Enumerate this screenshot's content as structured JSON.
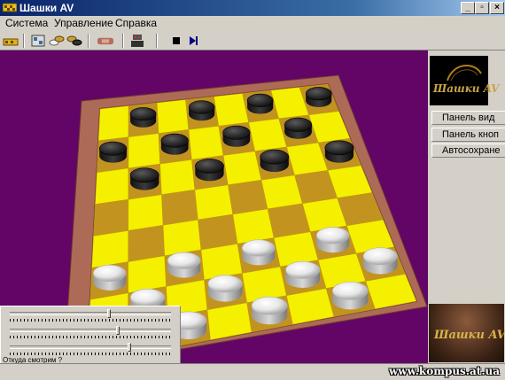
{
  "window": {
    "title": "Шашки AV",
    "icon": "checkers-app-icon",
    "controls": {
      "minimize": "_",
      "maximize": "▫",
      "close": "×"
    }
  },
  "menu": {
    "items": [
      "Система",
      "Управление",
      "Справка"
    ]
  },
  "toolbar": {
    "icons": [
      "new-game-icon",
      "board-view-icon",
      "white-pieces-icon",
      "handshake-icon",
      "robot-icon",
      "stop-icon",
      "play-step-icon"
    ]
  },
  "board": {
    "rows": 8,
    "cols": 8,
    "light_square_color": "#f5f000",
    "dark_square_color": "#c39320",
    "frame_color": "#ad6b57",
    "background_color": "#620566",
    "black_pieces": [
      [
        0,
        1
      ],
      [
        0,
        3
      ],
      [
        0,
        5
      ],
      [
        0,
        7
      ],
      [
        1,
        0
      ],
      [
        1,
        2
      ],
      [
        1,
        4
      ],
      [
        1,
        6
      ],
      [
        2,
        1
      ],
      [
        2,
        3
      ],
      [
        2,
        5
      ],
      [
        2,
        7
      ]
    ],
    "white_pieces": [
      [
        5,
        0
      ],
      [
        5,
        2
      ],
      [
        5,
        4
      ],
      [
        5,
        6
      ],
      [
        6,
        1
      ],
      [
        6,
        3
      ],
      [
        6,
        5
      ],
      [
        6,
        7
      ],
      [
        7,
        0
      ],
      [
        7,
        2
      ],
      [
        7,
        4
      ],
      [
        7,
        6
      ]
    ]
  },
  "sidebar": {
    "logo_text": "Шашки AV",
    "buttons": [
      "Панель вид",
      "Панель кноп",
      "Автосохране"
    ],
    "photo_text": "Шашки AV"
  },
  "camera": {
    "label": "Откуда смотрим ?",
    "sliders": [
      0.62,
      0.68,
      0.75
    ]
  },
  "watermark": "www.kompus.at.ua"
}
